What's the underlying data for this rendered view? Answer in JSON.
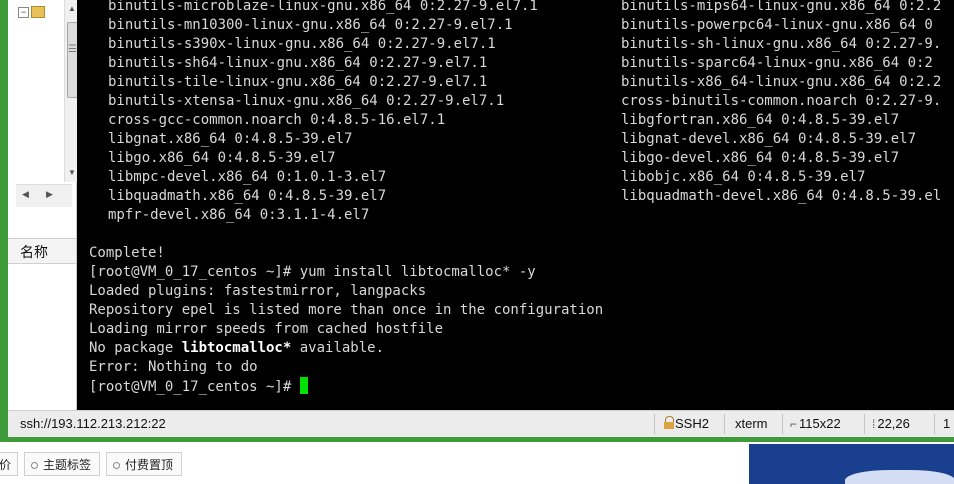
{
  "terminal": {
    "package_left": [
      "binutils-microblaze-linux-gnu.x86_64 0:2.27-9.el7.1",
      "binutils-mn10300-linux-gnu.x86_64 0:2.27-9.el7.1",
      "binutils-s390x-linux-gnu.x86_64 0:2.27-9.el7.1",
      "binutils-sh64-linux-gnu.x86_64 0:2.27-9.el7.1",
      "binutils-tile-linux-gnu.x86_64 0:2.27-9.el7.1",
      "binutils-xtensa-linux-gnu.x86_64 0:2.27-9.el7.1",
      "cross-gcc-common.noarch 0:4.8.5-16.el7.1",
      "libgnat.x86_64 0:4.8.5-39.el7",
      "libgo.x86_64 0:4.8.5-39.el7",
      "libmpc-devel.x86_64 0:1.0.1-3.el7",
      "libquadmath.x86_64 0:4.8.5-39.el7",
      "mpfr-devel.x86_64 0:3.1.1-4.el7"
    ],
    "package_right": [
      "binutils-mips64-linux-gnu.x86_64 0:2.2",
      "binutils-powerpc64-linux-gnu.x86_64 0",
      "binutils-sh-linux-gnu.x86_64 0:2.27-9.",
      "binutils-sparc64-linux-gnu.x86_64 0:2",
      "binutils-x86_64-linux-gnu.x86_64 0:2.2",
      "cross-binutils-common.noarch 0:2.27-9.",
      "libgfortran.x86_64 0:4.8.5-39.el7",
      "libgnat-devel.x86_64 0:4.8.5-39.el7",
      "libgo-devel.x86_64 0:4.8.5-39.el7",
      "libobjc.x86_64 0:4.8.5-39.el7",
      "libquadmath-devel.x86_64 0:4.8.5-39.el"
    ],
    "complete": "Complete!",
    "prompt1": "[root@VM_0_17_centos ~]# yum install libtocmalloc* -y",
    "loaded": "Loaded plugins: fastestmirror, langpacks",
    "repo": "Repository epel is listed more than once in the configuration",
    "mirror": "Loading mirror speeds from cached hostfile",
    "nopkg_prefix": "No package ",
    "nopkg_name": "libtocmalloc*",
    "nopkg_suffix": " available.",
    "error": "Error: Nothing to do",
    "prompt2": "[root@VM_0_17_centos ~]# "
  },
  "sidebar": {
    "name_label": "名称"
  },
  "status_bar": {
    "connection": "ssh://193.112.213.212:22",
    "protocol": "SSH2",
    "terminal_type": "xterm",
    "size": "115x22",
    "cursor_position": "22,26",
    "extra": "1"
  },
  "browser_tabs": [
    {
      "label": "价"
    },
    {
      "label": "主题标签"
    },
    {
      "label": "付费置顶"
    }
  ],
  "colors": {
    "frame_green": "#3f9a3a",
    "cursor_green": "#00e000",
    "terminal_bg": "#000000"
  }
}
